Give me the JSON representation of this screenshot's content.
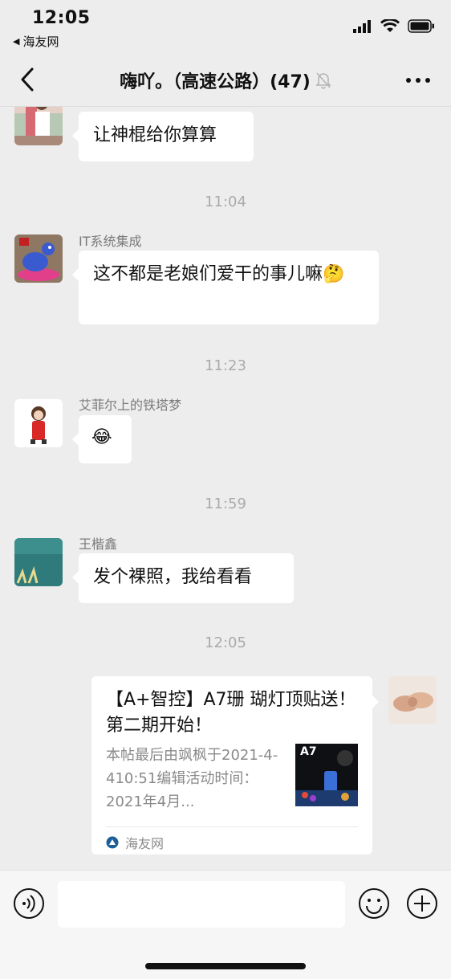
{
  "status_bar": {
    "time": "12:05",
    "back_app_label": "海友网",
    "icons": [
      "signal-icon",
      "wifi-icon",
      "battery-icon"
    ]
  },
  "nav": {
    "title": "嗨吖。（高速公路）(47)",
    "icons": [
      "back-arrow-icon",
      "mute-bell-icon",
      "more-icon"
    ]
  },
  "messages": [
    {
      "type": "text",
      "sender": "",
      "text": "让神棍给你算算"
    },
    {
      "type": "time",
      "text": "11:04"
    },
    {
      "type": "text",
      "sender": "IT系统集成",
      "text": "这不都是老娘们爱干的事儿嘛🤔"
    },
    {
      "type": "time",
      "text": "11:23"
    },
    {
      "type": "text",
      "sender": "艾菲尔上的铁塔梦",
      "text": "😂"
    },
    {
      "type": "time",
      "text": "11:59"
    },
    {
      "type": "text",
      "sender": "王楷鑫",
      "text": "发个裸照，我给看看"
    },
    {
      "type": "time",
      "text": "12:05"
    }
  ],
  "link_card": {
    "title": "【A+智控】A7珊 瑚灯顶贴送！第二期开始！",
    "description": "本帖最后由飒枫于2021-4-410:51编辑活动时间：2021年4月...",
    "thumb_label": "A7",
    "source": "海友网"
  },
  "input_bar": {
    "placeholder": "",
    "icons": [
      "voice-icon",
      "emoji-icon",
      "plus-icon"
    ]
  },
  "colors": {
    "background": "#ededed",
    "bubble": "#ffffff",
    "muted_text": "#aaaaaa"
  }
}
